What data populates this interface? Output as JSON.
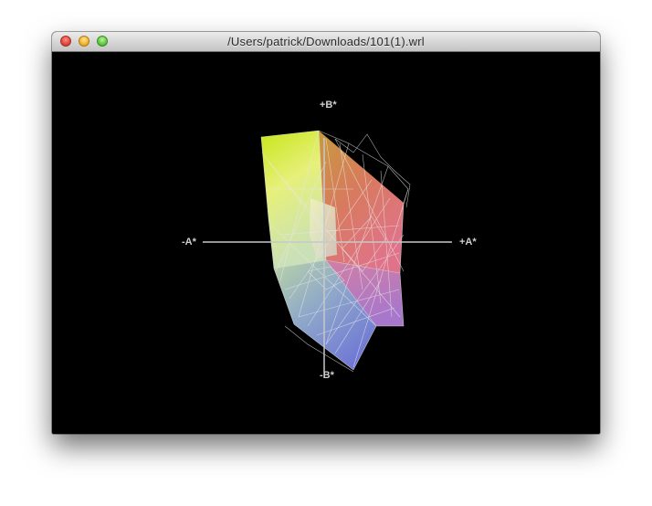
{
  "window": {
    "title": "/Users/patrick/Downloads/101(1).wrl",
    "buttons": [
      "close-button",
      "minimize-button",
      "zoom-button"
    ]
  },
  "viewer": {
    "background": "#000000",
    "axes": {
      "pos_b": "+B*",
      "neg_b": "-B*",
      "neg_a": "-A*",
      "pos_a": "+A*"
    }
  }
}
